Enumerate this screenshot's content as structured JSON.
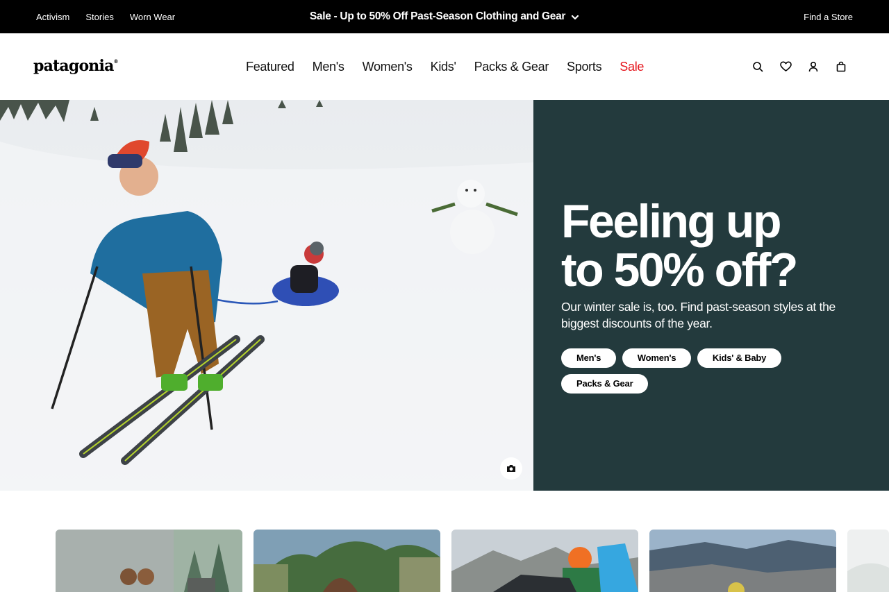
{
  "topbar": {
    "links": [
      "Activism",
      "Stories",
      "Worn Wear"
    ],
    "promo": "Sale - Up to 50% Off Past-Season Clothing and Gear",
    "find_store": "Find a Store"
  },
  "header": {
    "logo": "patagonia",
    "nav": [
      "Featured",
      "Men's",
      "Women's",
      "Kids'",
      "Packs & Gear",
      "Sports",
      "Sale"
    ],
    "icons": [
      "search-icon",
      "heart-icon",
      "account-icon",
      "bag-icon"
    ]
  },
  "hero": {
    "title_line1": "Feeling up",
    "title_line2": "to 50% off?",
    "subtitle": "Our winter sale is, too. Find past-season styles at the biggest discounts of the year.",
    "buttons": [
      "Men's",
      "Women's",
      "Kids' & Baby",
      "Packs & Gear"
    ],
    "panel_color": "#233a3d",
    "sale_color": "#e5141c"
  }
}
